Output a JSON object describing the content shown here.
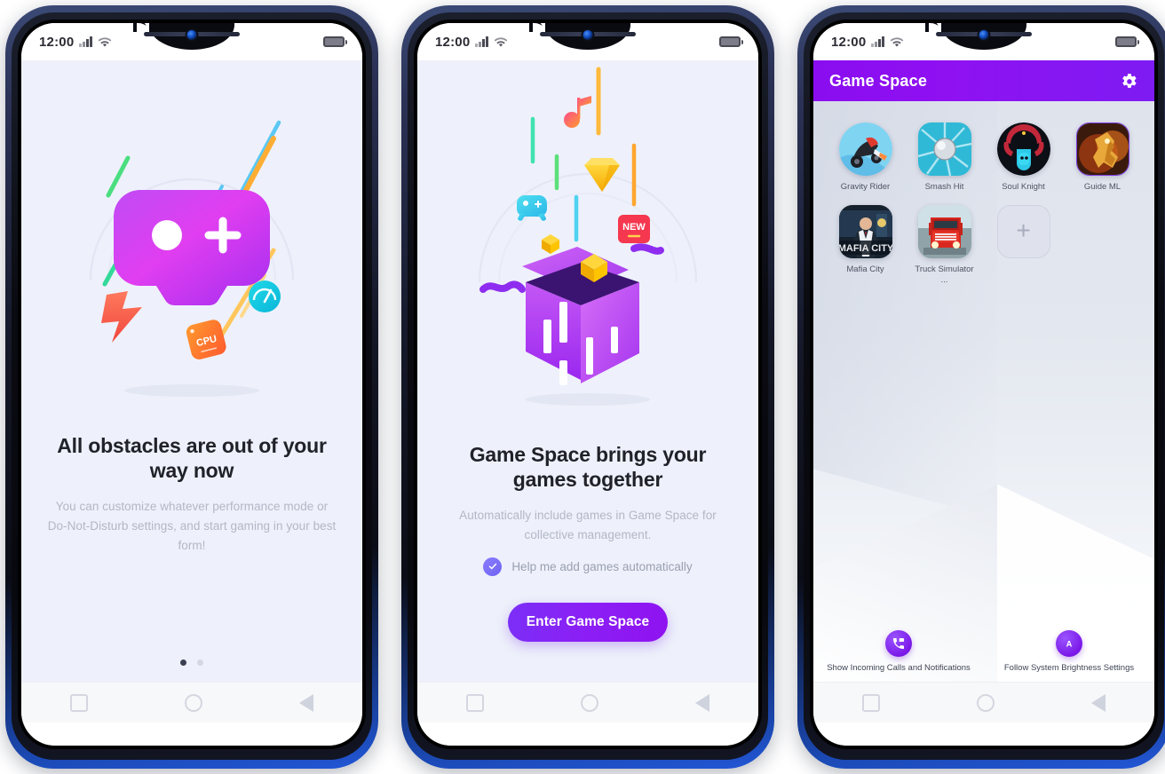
{
  "status_bar": {
    "time": "12:00",
    "signal_icon": "signal-bars-icon",
    "wifi_icon": "wifi-icon",
    "battery_icon": "battery-icon"
  },
  "nav_bar": {
    "recents_icon": "square-recents-icon",
    "home_icon": "circle-home-icon",
    "back_icon": "triangle-back-icon"
  },
  "screens": [
    {
      "id": "onboarding-obstacles",
      "illustration": "gamepad-illustration",
      "title": "All obstacles are out of your way now",
      "subtitle": "You can customize whatever performance mode or Do-Not-Disturb settings, and start gaming in your best form!",
      "pagination": {
        "total": 2,
        "active": 1
      }
    },
    {
      "id": "onboarding-game-space",
      "illustration": "open-box-illustration",
      "title": "Game Space brings your games together",
      "subtitle": "Automatically include games in Game Space for collective management.",
      "checkbox": {
        "label": "Help me add games automatically",
        "checked": true
      },
      "cta": "Enter Game Space"
    },
    {
      "id": "game-space-home",
      "header": {
        "title": "Game Space",
        "settings_icon": "gear-icon"
      },
      "games": [
        {
          "name": "Gravity Rider",
          "icon": "gravity-rider-icon",
          "shape": "circle"
        },
        {
          "name": "Smash Hit",
          "icon": "smash-hit-icon",
          "shape": "rounded"
        },
        {
          "name": "Soul Knight",
          "icon": "soul-knight-icon",
          "shape": "circle"
        },
        {
          "name": "Guide ML",
          "icon": "guide-ml-icon",
          "shape": "rounded"
        },
        {
          "name": "Mafia City",
          "icon": "mafia-city-icon",
          "shape": "rounded"
        },
        {
          "name": "Truck Simulator ...",
          "icon": "truck-simulator-icon",
          "shape": "rounded"
        }
      ],
      "add_button": {
        "label": "+",
        "name": "add-game-button"
      },
      "options": [
        {
          "label": "Show Incoming Calls and Notifications",
          "icon": "phone-call-icon"
        },
        {
          "label": "Follow System Brightness Settings",
          "icon": "auto-brightness-icon"
        }
      ]
    }
  ],
  "colors": {
    "accent_purple": "#7b2ff7",
    "header_gradient_start": "#8a0df0",
    "header_gradient_end": "#7e1bf3",
    "screen_bg": "#eef1fb",
    "title_text": "#212129",
    "subtitle_text": "#b3b7c6",
    "frame_blue": "#2256d6"
  }
}
